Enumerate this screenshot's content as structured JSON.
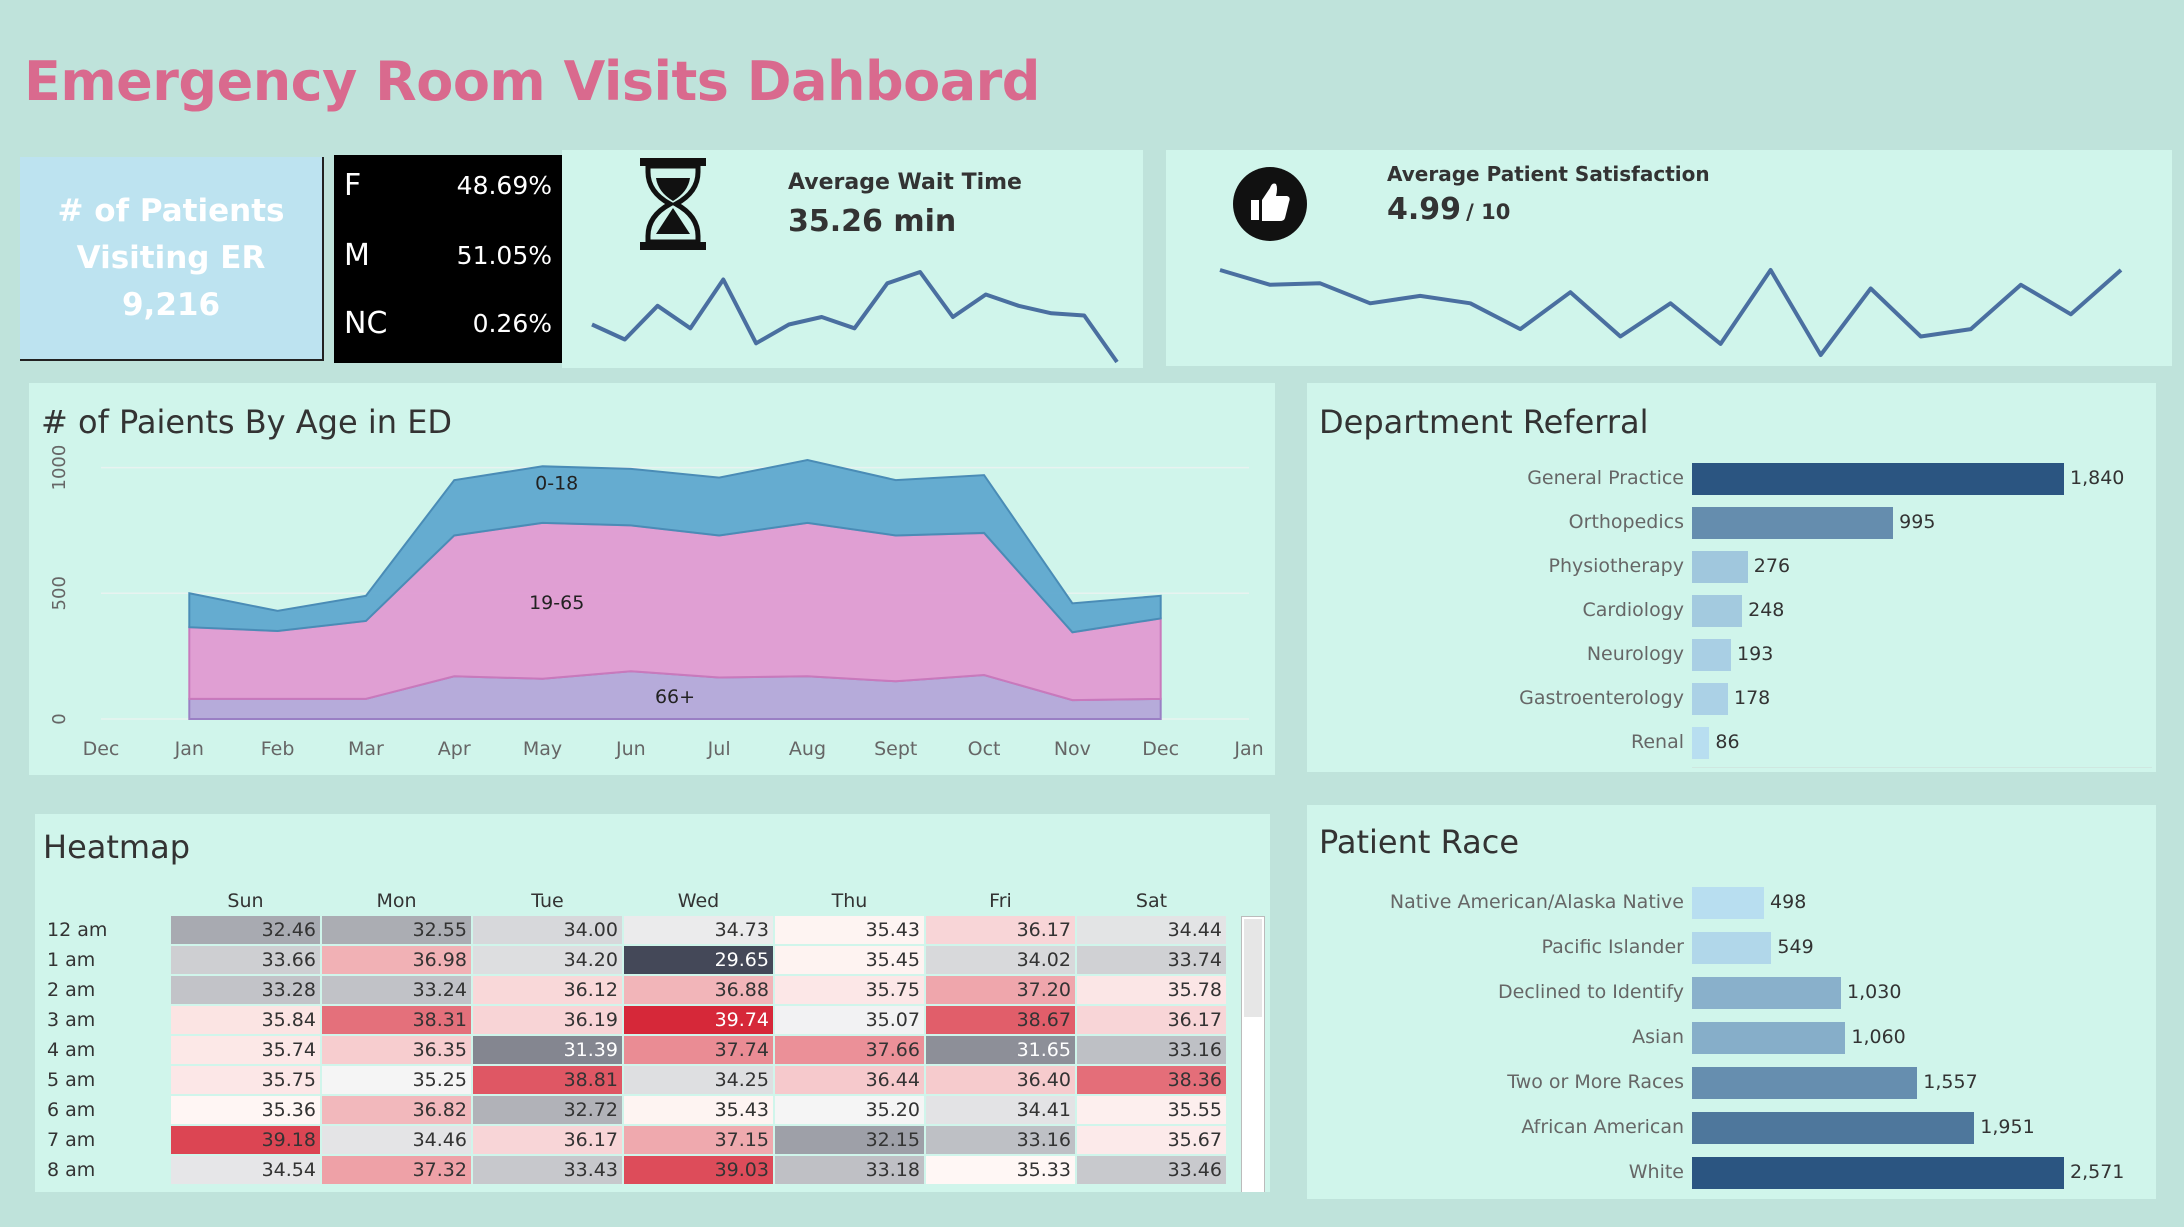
{
  "title": "Emergency Room Visits Dahboard",
  "patients_card": {
    "line1": "# of Patients",
    "line2": "Visiting ER",
    "value": "9,216"
  },
  "gender": [
    {
      "key": "F",
      "value": "48.69%"
    },
    {
      "key": "M",
      "value": "51.05%"
    },
    {
      "key": "NC",
      "value": "0.26%"
    }
  ],
  "wait": {
    "label": "Average Wait Time",
    "value": "35.26 min",
    "icon": "hourglass-icon"
  },
  "satisfaction": {
    "label": "Average Patient Satisfaction",
    "value": "4.99",
    "denom": "/ 10",
    "icon": "thumbs-up-icon"
  },
  "colors": {
    "title": "#d96a8e",
    "line": "#4a6fa0",
    "age_0_18": "#5fa8cf",
    "age_19_65": "#e09ad2",
    "age_66_plus": "#b3a3d8",
    "bar_dark": "#2b5581",
    "bar_light": "#b8def0"
  },
  "chart_data": [
    {
      "type": "line",
      "title": "Average Wait Time",
      "series": [
        {
          "values": [
            36.0,
            34.0,
            38.5,
            35.5,
            42.0,
            33.5,
            36.0,
            37.0,
            35.5,
            41.5,
            43.0,
            37.0,
            40.0,
            38.5,
            37.5,
            37.2,
            31.0
          ]
        }
      ]
    },
    {
      "type": "line",
      "title": "Average Patient Satisfaction",
      "series": [
        {
          "values": [
            5.4,
            5.2,
            5.22,
            4.95,
            5.05,
            4.95,
            4.6,
            5.1,
            4.5,
            4.95,
            4.4,
            5.4,
            4.25,
            5.15,
            4.5,
            4.6,
            5.2,
            4.8,
            5.4
          ]
        }
      ]
    },
    {
      "type": "area",
      "title": "# of Paients By Age in ED",
      "x": [
        "Jan",
        "Feb",
        "Mar",
        "Apr",
        "May",
        "Jun",
        "Jul",
        "Aug",
        "Sept",
        "Oct",
        "Nov",
        "Dec"
      ],
      "xticks": [
        "Dec",
        "Jan",
        "Feb",
        "Mar",
        "Apr",
        "May",
        "Jun",
        "Jul",
        "Aug",
        "Sept",
        "Oct",
        "Nov",
        "Dec",
        "Jan"
      ],
      "yticks": [
        0,
        500,
        1000
      ],
      "ylim": [
        0,
        1050
      ],
      "series": [
        {
          "name": "66+",
          "values": [
            80,
            80,
            80,
            170,
            160,
            190,
            165,
            170,
            150,
            175,
            75,
            80
          ]
        },
        {
          "name": "19-65",
          "values": [
            285,
            270,
            310,
            560,
            620,
            580,
            565,
            610,
            580,
            565,
            270,
            320
          ]
        },
        {
          "name": "0-18",
          "values": [
            135,
            80,
            100,
            220,
            225,
            225,
            230,
            250,
            220,
            230,
            115,
            90
          ]
        }
      ],
      "grid": true
    },
    {
      "type": "bar",
      "title": "Department Referral",
      "categories": [
        "General Practice",
        "Orthopedics",
        "Physiotherapy",
        "Cardiology",
        "Neurology",
        "Gastroenterology",
        "Renal"
      ],
      "values": [
        1840,
        995,
        276,
        248,
        193,
        178,
        86
      ],
      "labels": [
        "1,840",
        "995",
        "276",
        "248",
        "193",
        "178",
        "86"
      ]
    },
    {
      "type": "bar",
      "title": "Patient Race",
      "categories": [
        "Native American/Alaska Native",
        "Pacific Islander",
        "Declined to Identify",
        "Asian",
        "Two or More Races",
        "African American",
        "White"
      ],
      "values": [
        498,
        549,
        1030,
        1060,
        1557,
        1951,
        2571
      ],
      "labels": [
        "498",
        "549",
        "1,030",
        "1,060",
        "1,557",
        "1,951",
        "2,571"
      ]
    },
    {
      "type": "heatmap",
      "title": "Heatmap",
      "columns": [
        "Sun",
        "Mon",
        "Tue",
        "Wed",
        "Thu",
        "Fri",
        "Sat"
      ],
      "rows": [
        "12 am",
        "1 am",
        "2 am",
        "3 am",
        "4 am",
        "5 am",
        "6 am",
        "7 am",
        "8 am"
      ],
      "values": [
        [
          "32.46",
          "32.55",
          "34.00",
          "34.73",
          "35.43",
          "36.17",
          "34.44"
        ],
        [
          "33.66",
          "36.98",
          "34.20",
          "29.65",
          "35.45",
          "34.02",
          "33.74"
        ],
        [
          "33.28",
          "33.24",
          "36.12",
          "36.88",
          "35.75",
          "37.20",
          "35.78"
        ],
        [
          "35.84",
          "38.31",
          "36.19",
          "39.74",
          "35.07",
          "38.67",
          "36.17"
        ],
        [
          "35.74",
          "36.35",
          "31.39",
          "37.74",
          "37.66",
          "31.65",
          "33.16"
        ],
        [
          "35.75",
          "35.25",
          "38.81",
          "34.25",
          "36.44",
          "36.40",
          "38.36"
        ],
        [
          "35.36",
          "36.82",
          "32.72",
          "35.43",
          "35.20",
          "34.41",
          "35.55"
        ],
        [
          "39.18",
          "34.46",
          "36.17",
          "37.15",
          "32.15",
          "33.16",
          "35.67"
        ],
        [
          "34.54",
          "37.32",
          "33.43",
          "39.03",
          "33.18",
          "35.33",
          "33.46"
        ]
      ]
    }
  ]
}
